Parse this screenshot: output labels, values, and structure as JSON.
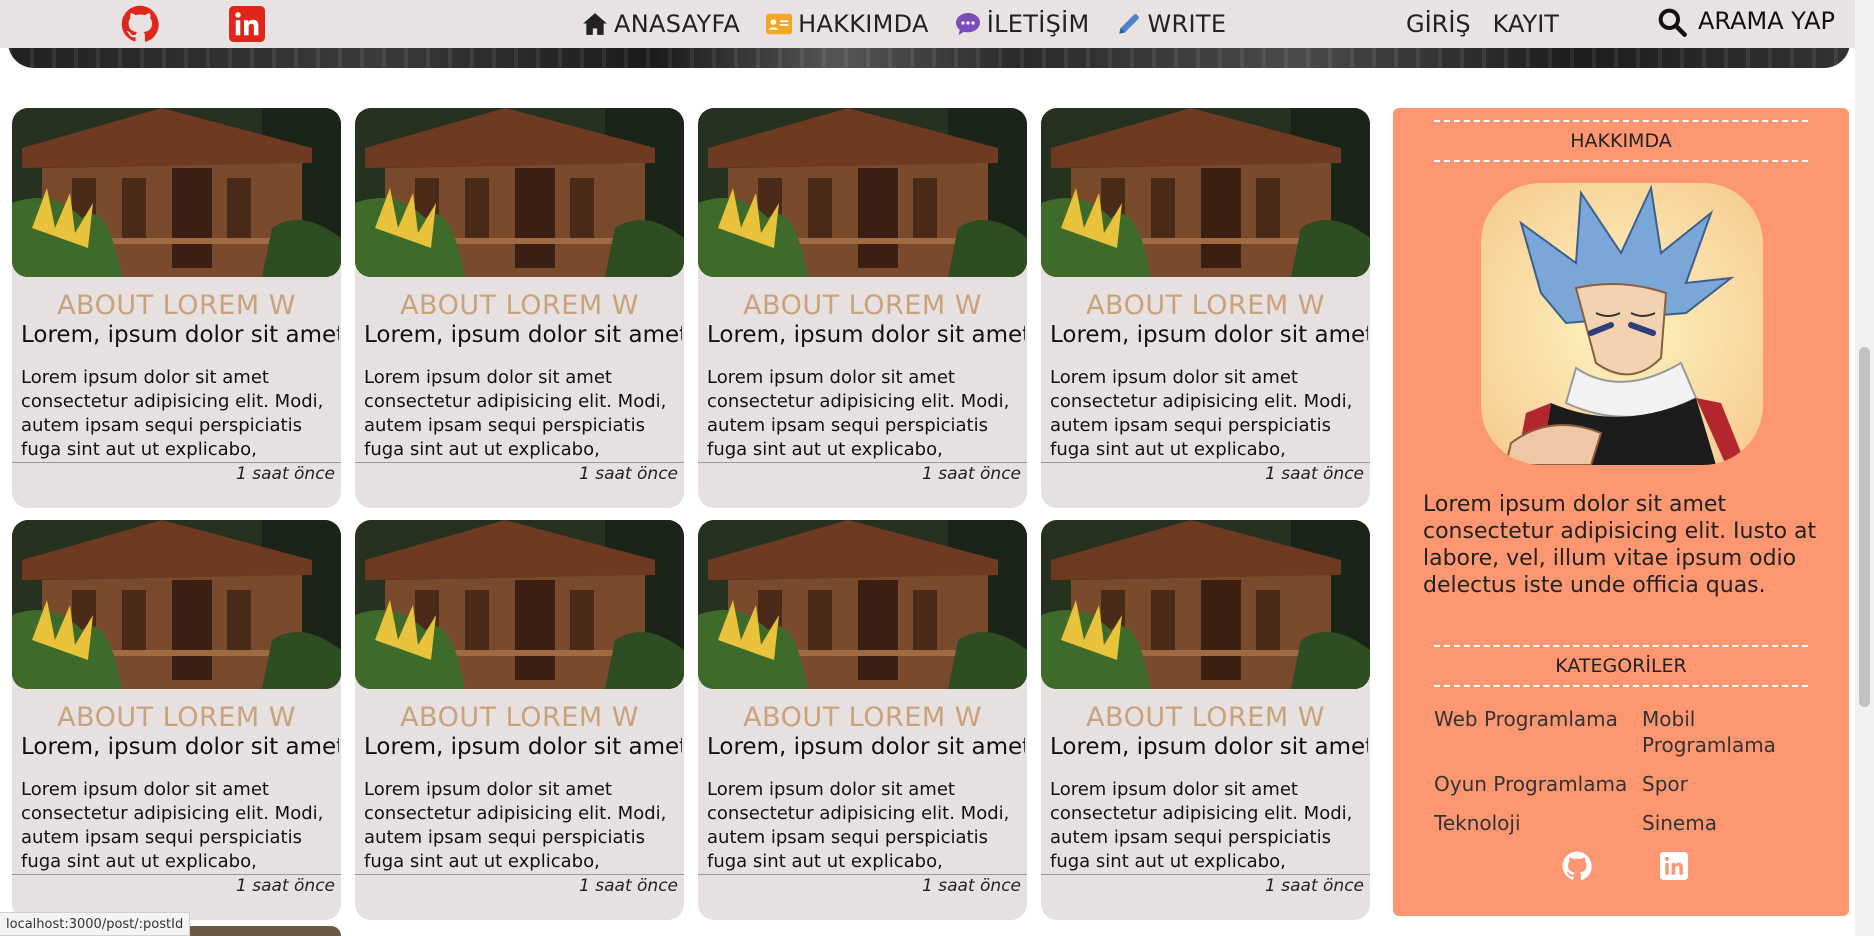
{
  "navbar": {
    "social": [
      "github-icon",
      "linkedin-icon"
    ],
    "items": [
      {
        "label": "ANASAYFA",
        "icon": "home-icon"
      },
      {
        "label": "HAKKIMDA",
        "icon": "id-card-icon"
      },
      {
        "label": "İLETİŞİM",
        "icon": "chat-icon"
      },
      {
        "label": "WRITE",
        "icon": "pencil-icon"
      }
    ],
    "login_label": "GİRİŞ",
    "register_label": "KAYIT",
    "search_label": "ARAMA YAP"
  },
  "posts": [
    {
      "category": "ABOUT LOREM W",
      "title": "Lorem, ipsum dolor sit amet",
      "excerpt": "Lorem ipsum dolor sit amet consectetur adipisicing elit. Modi, autem ipsam sequi perspiciatis fuga sint aut ut explicabo, voluptatum,...",
      "time": "1 saat önce"
    },
    {
      "category": "ABOUT LOREM W",
      "title": "Lorem, ipsum dolor sit amet",
      "excerpt": "Lorem ipsum dolor sit amet consectetur adipisicing elit. Modi, autem ipsam sequi perspiciatis fuga sint aut ut explicabo, voluptatum,...",
      "time": "1 saat önce"
    },
    {
      "category": "ABOUT LOREM W",
      "title": "Lorem, ipsum dolor sit amet",
      "excerpt": "Lorem ipsum dolor sit amet consectetur adipisicing elit. Modi, autem ipsam sequi perspiciatis fuga sint aut ut explicabo, voluptatum,...",
      "time": "1 saat önce"
    },
    {
      "category": "ABOUT LOREM W",
      "title": "Lorem, ipsum dolor sit amet",
      "excerpt": "Lorem ipsum dolor sit amet consectetur adipisicing elit. Modi, autem ipsam sequi perspiciatis fuga sint aut ut explicabo, voluptatum,...",
      "time": "1 saat önce"
    },
    {
      "category": "ABOUT LOREM W",
      "title": "Lorem, ipsum dolor sit amet",
      "excerpt": "Lorem ipsum dolor sit amet consectetur adipisicing elit. Modi, autem ipsam sequi perspiciatis fuga sint aut ut explicabo, voluptatum,...",
      "time": "1 saat önce"
    },
    {
      "category": "ABOUT LOREM W",
      "title": "Lorem, ipsum dolor sit amet",
      "excerpt": "Lorem ipsum dolor sit amet consectetur adipisicing elit. Modi, autem ipsam sequi perspiciatis fuga sint aut ut explicabo, voluptatum,...",
      "time": "1 saat önce"
    },
    {
      "category": "ABOUT LOREM W",
      "title": "Lorem, ipsum dolor sit amet",
      "excerpt": "Lorem ipsum dolor sit amet consectetur adipisicing elit. Modi, autem ipsam sequi perspiciatis fuga sint aut ut explicabo, voluptatum,...",
      "time": "1 saat önce"
    },
    {
      "category": "ABOUT LOREM W",
      "title": "Lorem, ipsum dolor sit amet",
      "excerpt": "Lorem ipsum dolor sit amet consectetur adipisicing elit. Modi, autem ipsam sequi perspiciatis fuga sint aut ut explicabo, voluptatum,...",
      "time": "1 saat önce"
    }
  ],
  "sidebar": {
    "about_title": "HAKKIMDA",
    "about_text": "Lorem ipsum dolor sit amet consectetur adipisicing elit. Iusto at labore, vel, illum vitae ipsum odio delectus iste unde officia quas.",
    "categories_title": "KATEGORİLER",
    "categories": [
      "Web Programlama",
      "Mobil Programlama",
      "Oyun Programlama",
      "Spor",
      "Teknoloji",
      "Sinema"
    ],
    "social": [
      "github-icon",
      "linkedin-icon"
    ],
    "colors": {
      "background": "#fd9771"
    }
  },
  "status_url": "localhost:3000/post/:postId"
}
